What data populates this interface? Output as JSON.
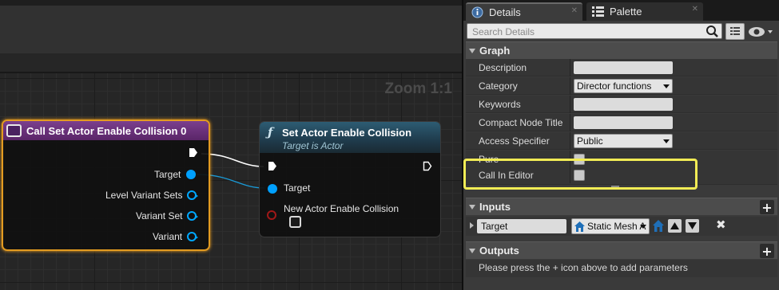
{
  "graph": {
    "zoom_label": "Zoom 1:1",
    "call_node": {
      "title": "Call Set Actor Enable Collision 0",
      "pins": [
        "Target",
        "Level Variant Sets",
        "Variant Set",
        "Variant"
      ]
    },
    "set_node": {
      "title": "Set Actor Enable Collision",
      "subtitle": "Target is Actor",
      "pins": [
        "Target",
        "New Actor Enable Collision"
      ]
    }
  },
  "tabs": [
    {
      "label": "Details",
      "icon": "details-info-icon"
    },
    {
      "label": "Palette",
      "icon": "palette-list-icon"
    }
  ],
  "search": {
    "placeholder": "Search Details"
  },
  "sections": {
    "graph": {
      "title": "Graph",
      "rows": [
        {
          "label": "Description",
          "value": ""
        },
        {
          "label": "Category",
          "value": "Director functions"
        },
        {
          "label": "Keywords",
          "value": ""
        },
        {
          "label": "Compact Node Title",
          "value": ""
        },
        {
          "label": "Access Specifier",
          "value": "Public"
        },
        {
          "label": "Pure",
          "value": ""
        },
        {
          "label": "Call In Editor",
          "value": ""
        }
      ]
    },
    "inputs": {
      "title": "Inputs",
      "row": {
        "name": "Target",
        "type": "Static Mesh A"
      }
    },
    "outputs": {
      "title": "Outputs",
      "info": "Please press the + icon above to add parameters"
    }
  },
  "colors": {
    "highlight": "#f2ec55",
    "selected_node_border": "#e39b21",
    "pin_blue": "#00a0ff",
    "pin_red": "#a01818"
  }
}
